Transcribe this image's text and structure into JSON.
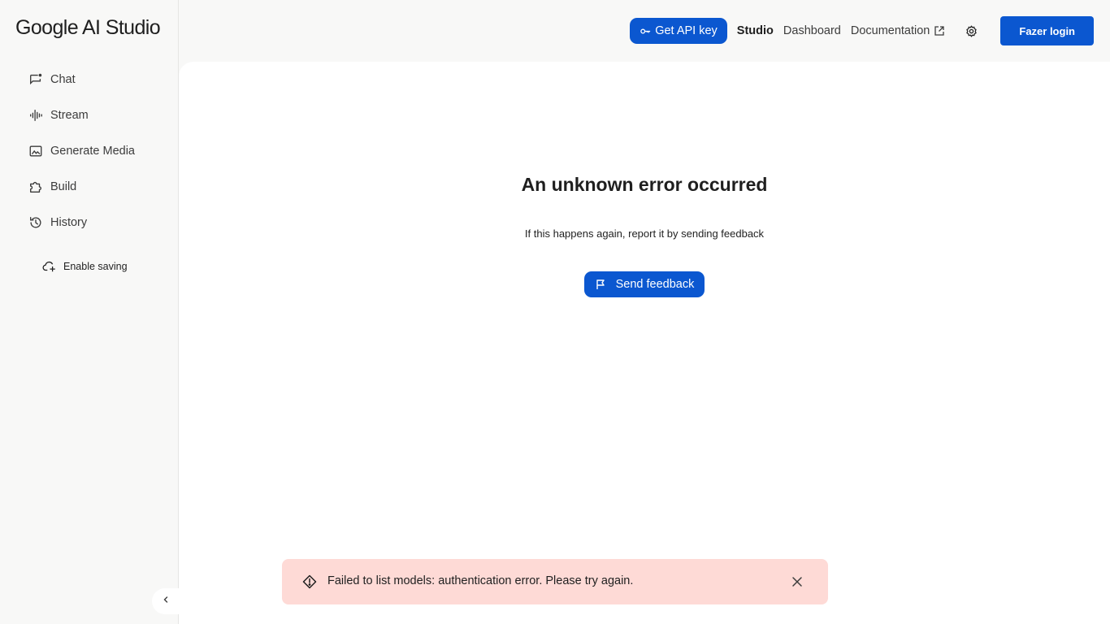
{
  "app": {
    "logo": "Google AI Studio"
  },
  "sidebar": {
    "items": [
      {
        "label": "Chat",
        "icon": "chat-icon"
      },
      {
        "label": "Stream",
        "icon": "waveform-icon"
      },
      {
        "label": "Generate Media",
        "icon": "image-icon"
      },
      {
        "label": "Build",
        "icon": "puzzle-icon"
      },
      {
        "label": "History",
        "icon": "history-icon"
      }
    ],
    "enable_saving": {
      "label": "Enable saving",
      "icon": "cloud-add-icon"
    },
    "collapse_icon": "chevron-left-icon"
  },
  "header": {
    "api_key_label": "Get API key",
    "links": [
      {
        "label": "Studio",
        "active": true
      },
      {
        "label": "Dashboard",
        "active": false
      },
      {
        "label": "Documentation",
        "active": false,
        "icon": "external-link-icon"
      }
    ],
    "settings_icon": "gear-icon",
    "login_label": "Fazer login"
  },
  "main": {
    "error_title": "An unknown error occurred",
    "error_subtitle": "If this happens again, report it by sending feedback",
    "feedback_label": "Send feedback"
  },
  "toast": {
    "message": "Failed to list models: authentication error. Please try again.",
    "icon": "warning-icon",
    "close_icon": "close-icon"
  },
  "colors": {
    "accent": "#0b57d0",
    "toast_bg": "#fedad6",
    "sidebar_bg": "#f8f8f7",
    "main_bg": "#ffffff"
  }
}
